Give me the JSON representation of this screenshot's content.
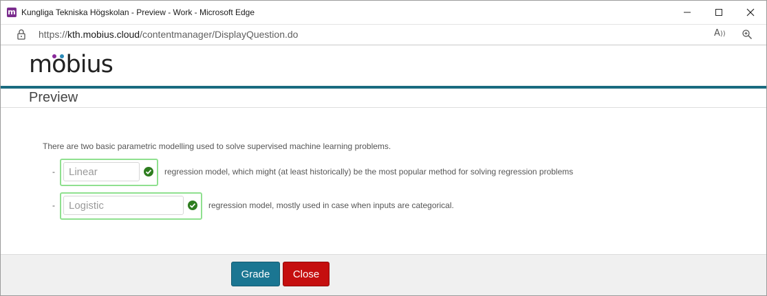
{
  "window": {
    "title": "Kungliga Tekniska Högskolan - Preview - Work - Microsoft Edge",
    "app_icon_glyph": "m",
    "app_icon_color": "#7b2d8e"
  },
  "addressbar": {
    "url_prefix": "https://",
    "url_host": "kth.mobius.cloud",
    "url_path": "/contentmanager/DisplayQuestion.do",
    "read_aloud_glyph": "A̅»"
  },
  "brand": {
    "logo_pre": "m",
    "logo_o": "o",
    "logo_post": "bius",
    "dot_colors": [
      "#8a2b9b",
      "#2b8ab8"
    ],
    "accent_color": "#1a6b80"
  },
  "page": {
    "title": "Preview",
    "question_text": "There are two basic parametric modelling used to solve supervised machine learning problems.",
    "answers": [
      {
        "dash": "-",
        "value": "Linear",
        "status": "correct",
        "after_text": "regression model, which might (at least historically) be the most popular method for solving regression problems"
      },
      {
        "dash": "-",
        "value": "Logistic",
        "status": "correct",
        "after_text": "regression model, mostly used in case when inputs are categorical."
      }
    ]
  },
  "footer": {
    "grade_label": "Grade",
    "close_label": "Close",
    "grade_color": "#1b7692",
    "close_color": "#c50f0f"
  }
}
